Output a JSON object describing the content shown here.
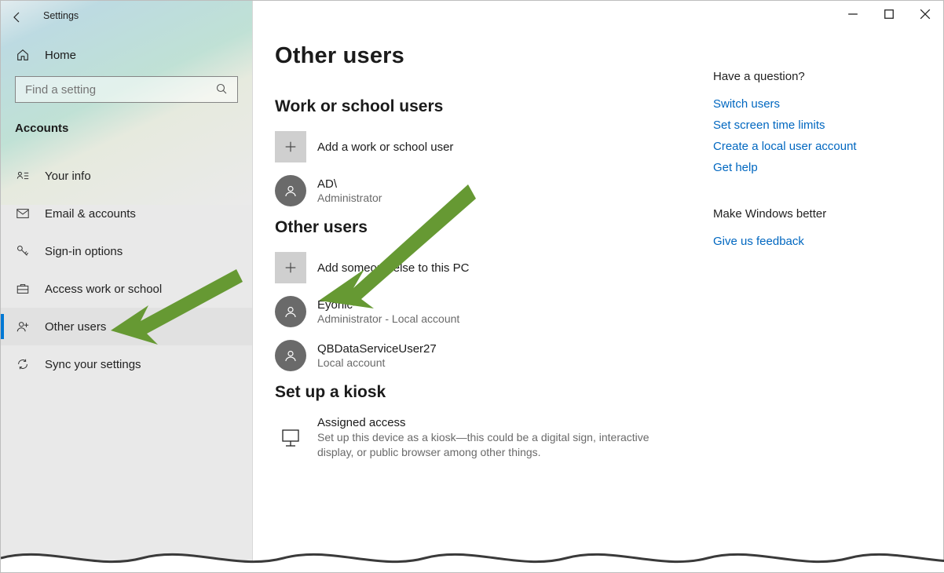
{
  "window": {
    "title": "Settings"
  },
  "sidebar": {
    "home_label": "Home",
    "search_placeholder": "Find a setting",
    "section_label": "Accounts",
    "items": [
      {
        "icon": "user-card",
        "label": "Your info"
      },
      {
        "icon": "mail",
        "label": "Email & accounts"
      },
      {
        "icon": "key",
        "label": "Sign-in options"
      },
      {
        "icon": "briefcase",
        "label": "Access work or school"
      },
      {
        "icon": "user-plus",
        "label": "Other users",
        "active": true
      },
      {
        "icon": "sync",
        "label": "Sync your settings"
      }
    ]
  },
  "page": {
    "title": "Other users",
    "sections": {
      "work_school": {
        "heading": "Work or school users",
        "add_label": "Add a work or school user",
        "users": [
          {
            "name": "AD\\",
            "role": "Administrator"
          }
        ]
      },
      "other": {
        "heading": "Other users",
        "add_label": "Add someone else to this PC",
        "users": [
          {
            "name": "Eyonic-",
            "role": "Administrator - Local account"
          },
          {
            "name": "QBDataServiceUser27",
            "role": "Local account"
          }
        ]
      },
      "kiosk": {
        "heading": "Set up a kiosk",
        "item_title": "Assigned access",
        "item_desc": "Set up this device as a kiosk—this could be a digital sign, interactive display, or public browser among other things."
      }
    }
  },
  "right": {
    "q_heading": "Have a question?",
    "links": [
      "Switch users",
      "Set screen time limits",
      "Create a local user account",
      "Get help"
    ],
    "fb_heading": "Make Windows better",
    "fb_link": "Give us feedback"
  }
}
